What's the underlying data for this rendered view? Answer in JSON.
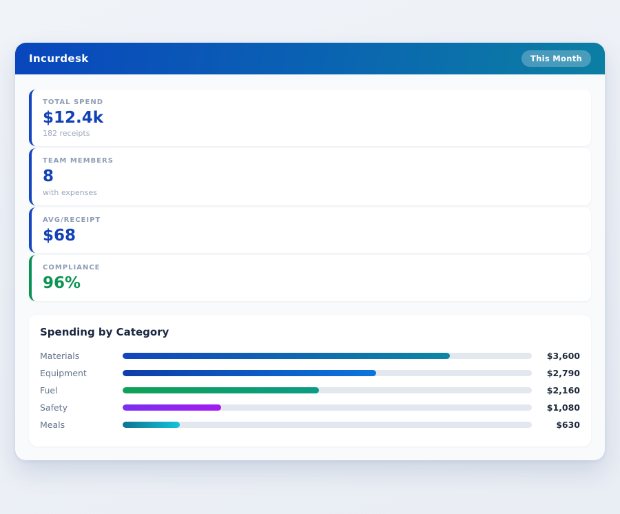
{
  "header": {
    "title": "Incurdesk",
    "badge": "This Month"
  },
  "stats": [
    {
      "label": "TOTAL SPEND",
      "value": "$12.4k",
      "sub": "182 receipts",
      "accent_color": "#1545c0",
      "value_color": "#1141b4"
    },
    {
      "label": "TEAM MEMBERS",
      "value": "8",
      "sub": "with expenses",
      "accent_color": "#1545c0",
      "value_color": "#1141b4"
    },
    {
      "label": "AVG/RECEIPT",
      "value": "$68",
      "sub": "",
      "accent_color": "#1545c0",
      "value_color": "#1141b4"
    },
    {
      "label": "COMPLIANCE",
      "value": "96%",
      "sub": "",
      "accent_color": "#0b9155",
      "value_color": "#0d9355"
    }
  ],
  "chart_data": {
    "type": "bar",
    "orientation": "horizontal",
    "title": "Spending by Category",
    "categories": [
      "Materials",
      "Equipment",
      "Fuel",
      "Safety",
      "Meals"
    ],
    "values": [
      3600,
      2790,
      2160,
      1080,
      630
    ],
    "value_labels": [
      "$3,600",
      "$2,790",
      "$2,160",
      "$1,080",
      "$630"
    ],
    "xlim": [
      0,
      4500
    ],
    "bar_pct": [
      80,
      62,
      48,
      24,
      14
    ],
    "bar_gradients": [
      [
        "#1245bd",
        "#0d86a5"
      ],
      [
        "#0f3da8",
        "#0b74dd"
      ],
      [
        "#0fa156",
        "#0c9b85"
      ],
      [
        "#7b2ff0",
        "#a21cf0"
      ],
      [
        "#0e7490",
        "#12c2dd"
      ]
    ],
    "track_color": "#e3e8ef",
    "grid": false,
    "legend": "none"
  },
  "colors": {
    "page_bg": "#edf1f7",
    "panel_bg": "#f8fafc",
    "card_bg": "#ffffff",
    "header_gradient": [
      "#0946bd",
      "#0c7fa3"
    ],
    "badge_bg": "rgba(255,255,255,0.25)",
    "accent_blue": "#1545c0",
    "accent_green": "#0b9155",
    "value_blue": "#1141b4",
    "value_green": "#0d9355",
    "label_gray": "#8e9db5"
  }
}
